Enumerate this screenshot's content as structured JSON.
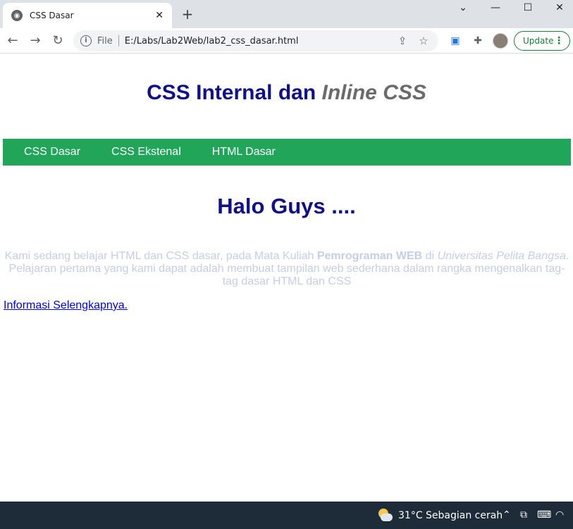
{
  "browser": {
    "tab_title": "CSS Dasar",
    "tab_close": "✕",
    "new_tab": "+",
    "window_controls": {
      "dropdown": "⌄",
      "minimize": "—",
      "maximize": "☐",
      "close": "✕"
    },
    "scheme_label": "File",
    "url": "E:/Labs/Lab2Web/lab2_css_dasar.html",
    "update_label": "Update",
    "accent_color": "#188038"
  },
  "page": {
    "title_main": "CSS Internal dan ",
    "title_italic": "Inline CSS",
    "nav_items": [
      "CSS Dasar",
      "CSS Ekstenal",
      "HTML Dasar"
    ],
    "nav_color": "#21a659",
    "heading": "Halo Guys ....",
    "paragraph": {
      "part1": "Kami sedang belajar HTML dan CSS dasar, pada Mata Kuliah ",
      "bold": "Pemrograman WEB",
      "part2": " di ",
      "italic": "Universitas Pelita Bangsa",
      "part3": ". Pelajaran pertama yang kami dapat adalah membuat tampilan web sederhana dalam rangka mengenalkan tag-tag dasar HTML dan CSS"
    },
    "link_text": "Informasi Selengkapnya."
  },
  "taskbar": {
    "temperature": "31°C",
    "condition": "Sebagian cerah"
  }
}
